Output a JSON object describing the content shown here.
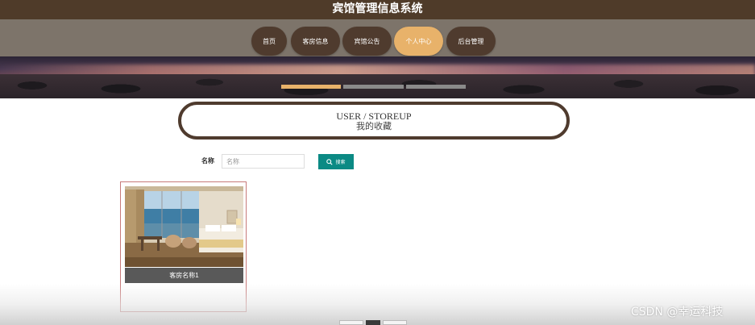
{
  "site": {
    "title": "宾馆管理信息系统"
  },
  "nav": {
    "items": [
      {
        "label": "首页",
        "active": false
      },
      {
        "label": "客房信息",
        "active": false
      },
      {
        "label": "宾馆公告",
        "active": false
      },
      {
        "label": "个人中心",
        "active": true
      },
      {
        "label": "后台管理",
        "active": false
      }
    ]
  },
  "heading": {
    "en": "USER / STOREUP",
    "cn": "我的收藏"
  },
  "search": {
    "label": "名称",
    "placeholder": "名称",
    "value": "",
    "button_label": "搜索"
  },
  "favorites": [
    {
      "name": "客房名称1"
    }
  ],
  "watermark": "CSDN @幸运科技",
  "colors": {
    "title_bar": "#4f3b29",
    "nav_bar": "#7d746a",
    "nav_item": "#4f3b2e",
    "nav_active": "#e8b26a",
    "search_button": "#0b8a84",
    "card_border": "#c77a7a"
  },
  "icons": {
    "search_button": "search-icon"
  }
}
